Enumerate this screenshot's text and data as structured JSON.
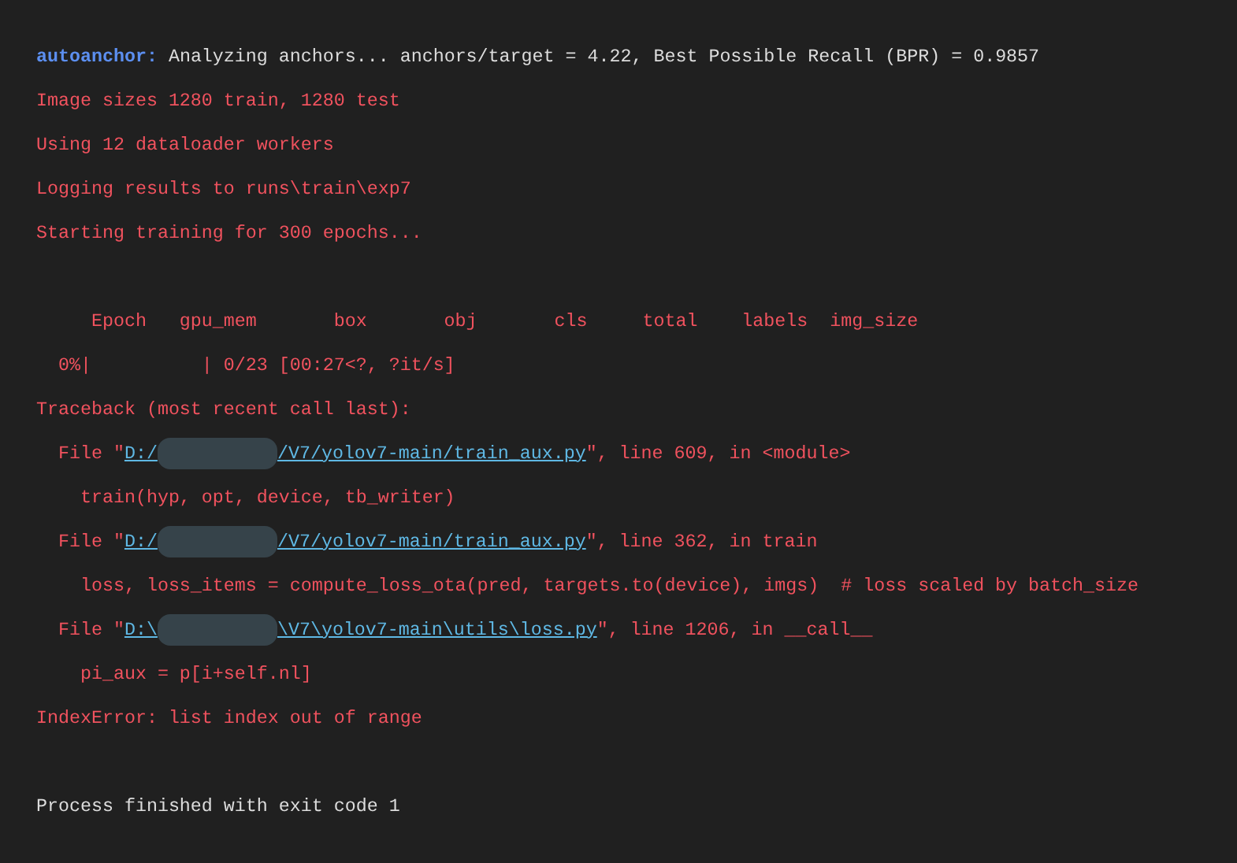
{
  "console": {
    "lines": [
      {
        "kind": "output",
        "segments": [
          {
            "kind": "prompt",
            "text": "autoanchor:"
          },
          {
            "kind": "info",
            "text": " Analyzing anchors... anchors/target = 4.22, Best Possible Recall (BPR) = 0.9857"
          }
        ]
      },
      {
        "kind": "output",
        "segments": [
          {
            "kind": "error",
            "text": "Image sizes 1280 train, 1280 test"
          }
        ]
      },
      {
        "kind": "output",
        "segments": [
          {
            "kind": "error",
            "text": "Using 12 dataloader workers"
          }
        ]
      },
      {
        "kind": "output",
        "segments": [
          {
            "kind": "error",
            "text": "Logging results to runs\\train\\exp7"
          }
        ]
      },
      {
        "kind": "output",
        "segments": [
          {
            "kind": "error",
            "text": "Starting training for 300 epochs..."
          }
        ]
      },
      {
        "kind": "blank"
      },
      {
        "kind": "output",
        "segments": [
          {
            "kind": "error",
            "text": "     Epoch   gpu_mem       box       obj       cls     total    labels  img_size"
          }
        ]
      },
      {
        "kind": "output",
        "segments": [
          {
            "kind": "error",
            "text": "  0%|          | 0/23 [00:27<?, ?it/s]"
          }
        ]
      },
      {
        "kind": "output",
        "segments": [
          {
            "kind": "error",
            "text": "Traceback (most recent call last):"
          }
        ]
      },
      {
        "kind": "output",
        "segments": [
          {
            "kind": "error",
            "text": "  File \""
          },
          {
            "kind": "link",
            "text": "D:/"
          },
          {
            "kind": "redacted"
          },
          {
            "kind": "link",
            "text": "/V7/yolov7-main/train_aux.py"
          },
          {
            "kind": "error",
            "text": "\", line 609, in <module>"
          }
        ]
      },
      {
        "kind": "output",
        "segments": [
          {
            "kind": "error",
            "text": "    train(hyp, opt, device, tb_writer)"
          }
        ]
      },
      {
        "kind": "output",
        "segments": [
          {
            "kind": "error",
            "text": "  File \""
          },
          {
            "kind": "link",
            "text": "D:/"
          },
          {
            "kind": "redacted"
          },
          {
            "kind": "link",
            "text": "/V7/yolov7-main/train_aux.py"
          },
          {
            "kind": "error",
            "text": "\", line 362, in train"
          }
        ]
      },
      {
        "kind": "output",
        "segments": [
          {
            "kind": "error",
            "text": "    loss, loss_items = compute_loss_ota(pred, targets.to(device), imgs)  # loss scaled by batch_size"
          }
        ]
      },
      {
        "kind": "output",
        "segments": [
          {
            "kind": "error",
            "text": "  File \""
          },
          {
            "kind": "link",
            "text": "D:\\"
          },
          {
            "kind": "redacted"
          },
          {
            "kind": "link",
            "text": "\\V7\\yolov7-main\\utils\\loss.py"
          },
          {
            "kind": "error",
            "text": "\", line 1206, in __call__"
          }
        ]
      },
      {
        "kind": "output",
        "segments": [
          {
            "kind": "error",
            "text": "    pi_aux = p[i+self.nl]"
          }
        ]
      },
      {
        "kind": "output",
        "segments": [
          {
            "kind": "error",
            "text": "IndexError: list index out of range"
          }
        ]
      },
      {
        "kind": "blank"
      },
      {
        "kind": "output",
        "segments": [
          {
            "kind": "info",
            "text": "Process finished with exit code 1"
          }
        ]
      }
    ]
  }
}
